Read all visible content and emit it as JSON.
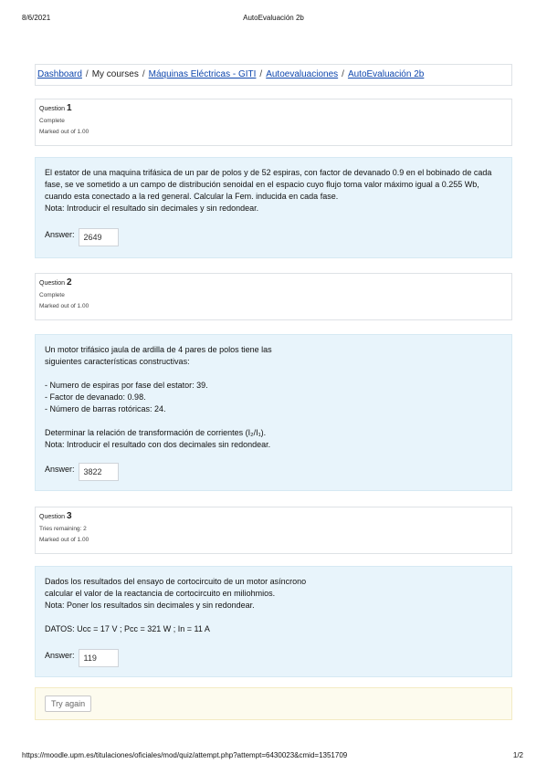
{
  "header": {
    "date": "8/6/2021",
    "title": "AutoEvaluación 2b"
  },
  "breadcrumb": {
    "items": [
      {
        "label": "Dashboard",
        "link": true
      },
      {
        "label": "My courses",
        "link": false
      },
      {
        "label": "Máquinas Eléctricas - GITI",
        "link": true
      },
      {
        "label": "Autoevaluaciones",
        "link": true
      },
      {
        "label": "AutoEvaluación 2b",
        "link": true
      }
    ],
    "separator": "/"
  },
  "questions": [
    {
      "question_label": "Question",
      "number": "1",
      "state": "Complete",
      "mark": "Marked out of 1.00",
      "text": [
        "El estator de una maquina trifásica de un par de polos y de 52 espiras, con factor de devanado 0.9 en el bobinado de cada fase, se ve sometido a un campo de distribución senoidal en el espacio cuyo flujo toma valor máximo igual a 0.255 Wb, cuando esta conectado a la red general. Calcular la Fem. inducida en cada fase.",
        "Nota: Introducir el resultado sin decimales y sin redondear."
      ],
      "answer_label": "Answer:",
      "answer_value": "2649"
    },
    {
      "question_label": "Question",
      "number": "2",
      "state": "Complete",
      "mark": "Marked out of 1.00",
      "text": [
        "Un motor trifásico jaula de ardilla de 4 pares de polos tiene las",
        "siguientes características constructivas:",
        "",
        "- Numero de espiras por fase del estator: 39.",
        "- Factor de devanado: 0.98.",
        "- Número de barras rotóricas: 24.",
        "",
        "Determinar la relación de transformación de corrientes (I₂/I₁).",
        "Nota: Introducir el resultado con dos decimales sin redondear."
      ],
      "answer_label": "Answer:",
      "answer_value": "3822"
    },
    {
      "question_label": "Question",
      "number": "3",
      "state": "Tries remaining: 2",
      "mark": "Marked out of 1.00",
      "text": [
        "Dados los resultados del ensayo de cortocircuito de un motor asíncrono",
        "calcular el valor de la reactancia de cortocircuito en miliohmios.",
        "Nota: Poner los resultados sin decimales y sin redondear.",
        "",
        "DATOS: Ucc = 17 V ; Pcc = 321 W ; In = 11 A"
      ],
      "answer_label": "Answer:",
      "answer_value": "119"
    }
  ],
  "try_again_label": "Try again",
  "footer": {
    "url": "https://moodle.upm.es/titulaciones/oficiales/mod/quiz/attempt.php?attempt=6430023&cmid=1351709",
    "page": "1/2"
  }
}
